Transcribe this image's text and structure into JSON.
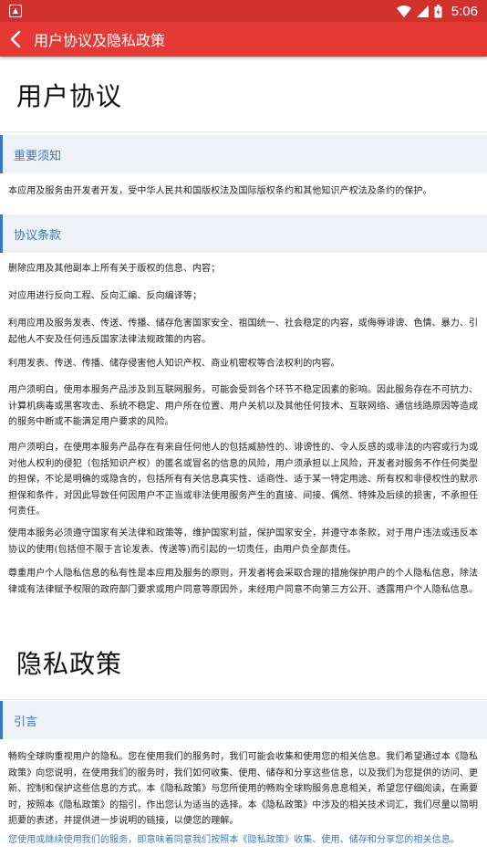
{
  "status_bar": {
    "time": "5:06"
  },
  "app_bar": {
    "title": "用户协议及隐私政策"
  },
  "sections": {
    "agreement_title": "用户协议",
    "notice_header": "重要须知",
    "notice_text": "本应用及服务由开发者开发，受中华人民共和国版权法及国际版权条约和其他知识产权法及条约的保护。",
    "terms_header": "协议条款",
    "terms": [
      "删除应用及其他副本上所有关于版权的信息、内容；",
      "对应用进行反向工程、反向汇编、反向编译等；",
      "利用应用及服务发表、传送、传播、储存危害国家安全、祖国统一、社会稳定的内容，或侮辱诽谤、色情、暴力、引起他人不安及任何违反国家法律法规政策的内容。",
      "利用发表、传送、传播、储存侵害他人知识产权、商业机密权等合法权利的内容。",
      "用户须明白，使用本服务产品涉及到互联网服务，可能会受到各个环节不稳定因素的影响。因此服务存在不可抗力、计算机病毒或黑客攻击、系统不稳定、用户所在位置、用户关机以及其他任何技术、互联网络、通信线路原因等造成的服务中断或不能满足用户要求的风险。",
      "用户须明白，在使用本服务产品存在有来自任何他人的包括威胁性的、诽谤性的、令人反感的或非法的内容或行为或对他人权利的侵犯（包括知识产权）的匿名或冒名的信息的风险，用户须承担以上风险，开发者对服务不作任何类型的担保，不论是明确的或隐含的，包括所有有关信息真实性、适商性、适于某一特定用途、所有权和非侵权性的默示担保和条件，对因此导致任何因用户不正当或非法使用服务产生的直接、间接、偶然、特殊及后续的损害，不承担任何责任。",
      "使用本服务必须遵守国家有关法律和政策等，维护国家利益，保护国家安全，并遵守本条款，对于用户违法或违反本协议的使用(包括但不限于言论发表、传送等)而引起的一切责任，由用户负全部责任。",
      "尊重用户个人隐私信息的私有性是本应用及服务的原则，开发者将会采取合理的措施保护用户的个人隐私信息，除法律或有法律赋予权限的政府部门要求或用户同意等原因外，未经用户同意不向第三方公开、透露用户个人隐私信息。"
    ],
    "privacy_title": "隐私政策",
    "intro_header": "引言",
    "intro_text": "畅购全球购重视用户的隐私。您在使用我们的服务时，我们可能会收集和使用您的相关信息。我们希望通过本《隐私政策》向您说明，在使用我们的服务时，我们如何收集、使用、储存和分享这些信息，以及我们为您提供的访问、更新、控制和保护这些信息的方式。本《隐私政策》与您所使用的畅购全球购服务息息相关，希望您仔细阅读，在需要时，按照本《隐私政策》的指引，作出您认为适当的选择。本《隐私政策》中涉及的相关技术词汇，我们尽量以简明扼要的表述，并提供进一步说明的链接，以便您的理解。",
    "intro_link": "您使用或继续使用我们的服务，即意味着同意我们按照本《隐私政策》收集、使用、储存和分享您的相关信息。"
  },
  "colors": {
    "status_bar": "#d0312d",
    "app_bar": "#e53935",
    "accent": "#3a78c2",
    "header_bg": "#eef1f6"
  }
}
